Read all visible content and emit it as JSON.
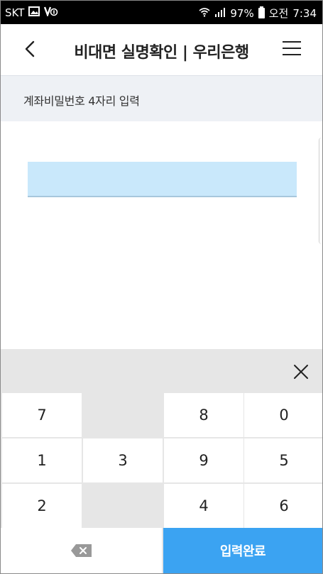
{
  "status_bar": {
    "carrier": "SKT",
    "battery": "97%",
    "ampm": "오전",
    "time": "7:34"
  },
  "header": {
    "title": "비대면 실명확인 | 우리은행"
  },
  "subheader": {
    "label": "계좌비밀번호 4자리 입력"
  },
  "password": {
    "value": ""
  },
  "keypad": {
    "rows": [
      [
        "7",
        "",
        "8",
        "0"
      ],
      [
        "1",
        "3",
        "9",
        "5"
      ],
      [
        "2",
        "",
        "4",
        "6"
      ]
    ],
    "submit_label": "입력완료"
  },
  "colors": {
    "accent": "#3ba3f2",
    "field_bg": "#c9e8fb"
  },
  "icons": [
    "back-arrow-icon",
    "menu-icon",
    "close-icon",
    "backspace-icon",
    "wifi-icon",
    "signal-icon",
    "battery-icon",
    "image-icon",
    "volte-icon"
  ]
}
